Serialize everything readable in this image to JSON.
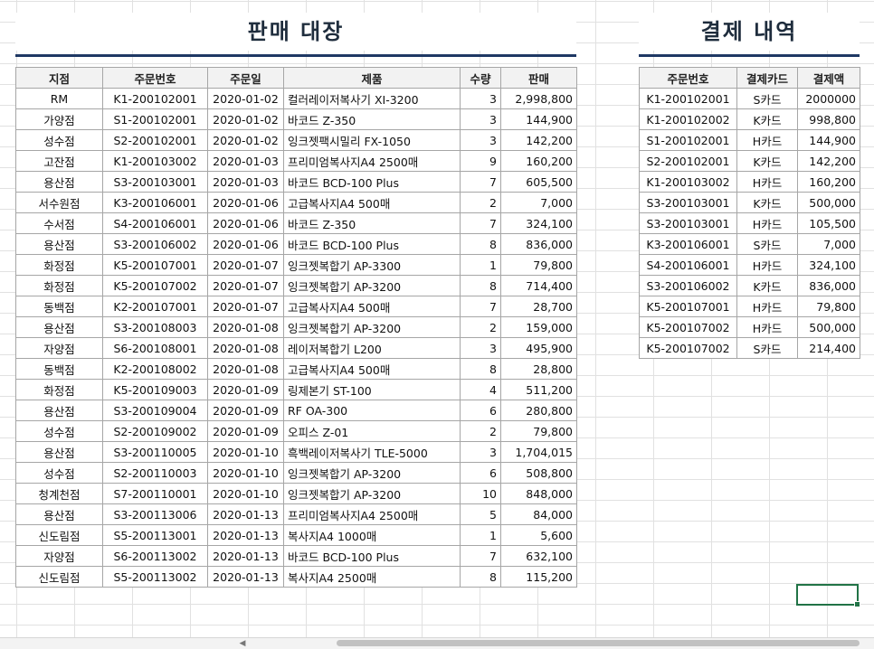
{
  "sales_title": "판매 대장",
  "payments_title": "결제 내역",
  "sales_headers": [
    "지점",
    "주문번호",
    "주문일",
    "제품",
    "수량",
    "판매"
  ],
  "sales_rows": [
    [
      "RM",
      "K1-200102001",
      "2020-01-02",
      "컬러레이저복사기 XI-3200",
      "3",
      "2,998,800"
    ],
    [
      "가양점",
      "S1-200102001",
      "2020-01-02",
      "바코드 Z-350",
      "3",
      "144,900"
    ],
    [
      "성수점",
      "S2-200102001",
      "2020-01-02",
      "잉크젯팩시밀리 FX-1050",
      "3",
      "142,200"
    ],
    [
      "고잔점",
      "K1-200103002",
      "2020-01-03",
      "프리미엄복사지A4 2500매",
      "9",
      "160,200"
    ],
    [
      "용산점",
      "S3-200103001",
      "2020-01-03",
      "바코드 BCD-100 Plus",
      "7",
      "605,500"
    ],
    [
      "서수원점",
      "K3-200106001",
      "2020-01-06",
      "고급복사지A4 500매",
      "2",
      "7,000"
    ],
    [
      "수서점",
      "S4-200106001",
      "2020-01-06",
      "바코드 Z-350",
      "7",
      "324,100"
    ],
    [
      "용산점",
      "S3-200106002",
      "2020-01-06",
      "바코드 BCD-100 Plus",
      "8",
      "836,000"
    ],
    [
      "화정점",
      "K5-200107001",
      "2020-01-07",
      "잉크젯복합기 AP-3300",
      "1",
      "79,800"
    ],
    [
      "화정점",
      "K5-200107002",
      "2020-01-07",
      "잉크젯복합기 AP-3200",
      "8",
      "714,400"
    ],
    [
      "동백점",
      "K2-200107001",
      "2020-01-07",
      "고급복사지A4 500매",
      "7",
      "28,700"
    ],
    [
      "용산점",
      "S3-200108003",
      "2020-01-08",
      "잉크젯복합기 AP-3200",
      "2",
      "159,000"
    ],
    [
      "자양점",
      "S6-200108001",
      "2020-01-08",
      "레이저복합기 L200",
      "3",
      "495,900"
    ],
    [
      "동백점",
      "K2-200108002",
      "2020-01-08",
      "고급복사지A4 500매",
      "8",
      "28,800"
    ],
    [
      "화정점",
      "K5-200109003",
      "2020-01-09",
      "링제본기 ST-100",
      "4",
      "511,200"
    ],
    [
      "용산점",
      "S3-200109004",
      "2020-01-09",
      "RF OA-300",
      "6",
      "280,800"
    ],
    [
      "성수점",
      "S2-200109002",
      "2020-01-09",
      "오피스 Z-01",
      "2",
      "79,800"
    ],
    [
      "용산점",
      "S3-200110005",
      "2020-01-10",
      "흑백레이저복사기 TLE-5000",
      "3",
      "1,704,015"
    ],
    [
      "성수점",
      "S2-200110003",
      "2020-01-10",
      "잉크젯복합기 AP-3200",
      "6",
      "508,800"
    ],
    [
      "청계천점",
      "S7-200110001",
      "2020-01-10",
      "잉크젯복합기 AP-3200",
      "10",
      "848,000"
    ],
    [
      "용산점",
      "S3-200113006",
      "2020-01-13",
      "프리미엄복사지A4 2500매",
      "5",
      "84,000"
    ],
    [
      "신도림점",
      "S5-200113001",
      "2020-01-13",
      "복사지A4 1000매",
      "1",
      "5,600"
    ],
    [
      "자양점",
      "S6-200113002",
      "2020-01-13",
      "바코드 BCD-100 Plus",
      "7",
      "632,100"
    ],
    [
      "신도림점",
      "S5-200113002",
      "2020-01-13",
      "복사지A4 2500매",
      "8",
      "115,200"
    ]
  ],
  "payment_headers": [
    "주문번호",
    "결제카드",
    "결제액"
  ],
  "payment_rows": [
    [
      "K1-200102001",
      "S카드",
      "2000000"
    ],
    [
      "K1-200102002",
      "K카드",
      "998,800"
    ],
    [
      "S1-200102001",
      "H카드",
      "144,900"
    ],
    [
      "S2-200102001",
      "K카드",
      "142,200"
    ],
    [
      "K1-200103002",
      "H카드",
      "160,200"
    ],
    [
      "S3-200103001",
      "K카드",
      "500,000"
    ],
    [
      "S3-200103001",
      "H카드",
      "105,500"
    ],
    [
      "K3-200106001",
      "S카드",
      "7,000"
    ],
    [
      "S4-200106001",
      "H카드",
      "324,100"
    ],
    [
      "S3-200106002",
      "K카드",
      "836,000"
    ],
    [
      "K5-200107001",
      "H카드",
      "79,800"
    ],
    [
      "K5-200107002",
      "H카드",
      "500,000"
    ],
    [
      "K5-200107002",
      "S카드",
      "214,400"
    ]
  ],
  "colors": {
    "title_underline": "#1f3864",
    "header_fill": "#f2f2f2",
    "selection": "#217346"
  },
  "icons": {
    "scroll_left": "triangle-left-icon"
  }
}
